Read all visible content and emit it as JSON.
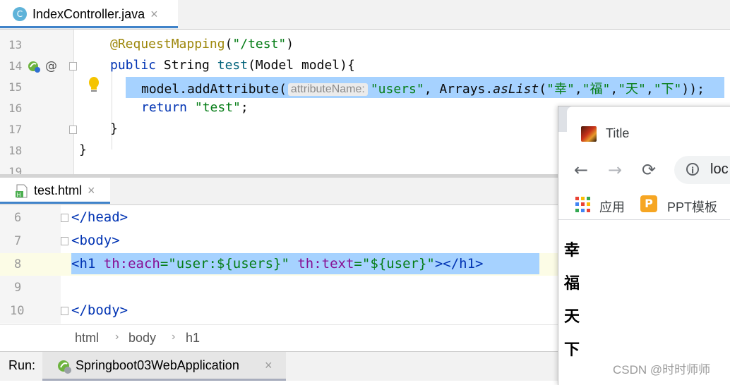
{
  "editor_tab_top": {
    "icon_letter": "C",
    "label": "IndexController.java",
    "close": "×"
  },
  "editor_top": {
    "line_numbers": [
      "13",
      "14",
      "15",
      "16",
      "17",
      "18",
      "19"
    ],
    "lines": {
      "l13_ann": "@RequestMapping",
      "l13_open": "(",
      "l13_str": "\"/test\"",
      "l13_close": ")",
      "l14_kw": "public",
      "l14_type": " String ",
      "l14_meth": "test",
      "l14_rest": "(Model model){",
      "l15_pre": "model.addAttribute(",
      "l15_hint": "attributeName:",
      "l15_str": "\"users\"",
      "l15_mid": ", Arrays.",
      "l15_meth": "asList",
      "l15_args_open": "(",
      "l15_a1": "\"幸\"",
      "l15_a2": "\"福\"",
      "l15_a3": "\"天\"",
      "l15_a4": "\"下\"",
      "l15_comma": ",",
      "l15_end": "));",
      "l16_kw": "return",
      "l16_str": " \"test\"",
      "l16_end": ";",
      "l17": "}",
      "l18": "}"
    },
    "gutter_at": "@"
  },
  "editor_tab_bottom": {
    "icon_letter": "H",
    "label": "test.html",
    "close": "×"
  },
  "editor_bottom": {
    "line_numbers": [
      "6",
      "7",
      "8",
      "9",
      "10"
    ],
    "lines": {
      "l6": "</head>",
      "l7": "<body>",
      "l8_open": "<h1 ",
      "l8_attr1": "th:each",
      "l8_eq1": "=",
      "l8_val1": "\"user:${users}\"",
      "l8_sp": " ",
      "l8_attr2": "th:text",
      "l8_eq2": "=",
      "l8_val2": "\"${user}\"",
      "l8_close": "></h1>",
      "l10": "</body>"
    }
  },
  "breadcrumb": [
    "html",
    "body",
    "h1"
  ],
  "breadcrumb_sep": "›",
  "run_bar": {
    "label": "Run:",
    "app": "Springboot03WebApplication",
    "close": "×"
  },
  "browser": {
    "tab_title": "Title",
    "back": "←",
    "forward": "→",
    "reload": "⟳",
    "info": "i",
    "url": "loc",
    "bookmarks": [
      {
        "label": "应用",
        "icon": "apps-grid-icon"
      },
      {
        "label": "PPT模板",
        "icon": "ppt-logo-icon",
        "logo_letter": "P"
      }
    ],
    "content_items": [
      "幸",
      "福",
      "天",
      "下"
    ]
  },
  "watermark": "CSDN @时时师师",
  "colors": {
    "selection": "#a6d2ff",
    "keyword": "#0033b3",
    "string": "#067d17",
    "annotation": "#9e880d",
    "attribute": "#871094",
    "tab_underline": "#4083c9"
  }
}
